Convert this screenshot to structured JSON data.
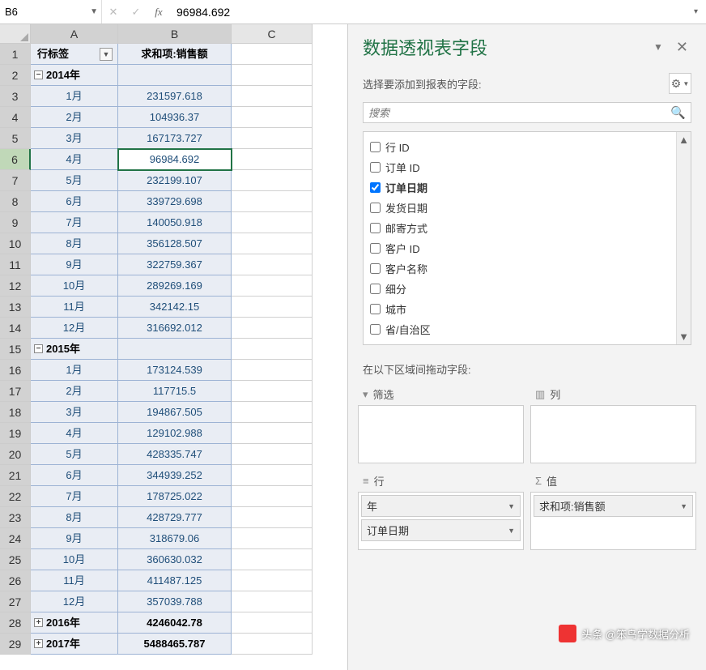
{
  "formula_bar": {
    "cell_ref": "B6",
    "value": "96984.692"
  },
  "columns": [
    "A",
    "B",
    "C"
  ],
  "headers": {
    "a": "行标签",
    "b": "求和项:销售额"
  },
  "rows": [
    {
      "n": 1,
      "type": "header"
    },
    {
      "n": 2,
      "type": "year",
      "label": "2014年",
      "exp": "−"
    },
    {
      "n": 3,
      "a": "1月",
      "b": "231597.618"
    },
    {
      "n": 4,
      "a": "2月",
      "b": "104936.37"
    },
    {
      "n": 5,
      "a": "3月",
      "b": "167173.727"
    },
    {
      "n": 6,
      "a": "4月",
      "b": "96984.692",
      "active": true
    },
    {
      "n": 7,
      "a": "5月",
      "b": "232199.107"
    },
    {
      "n": 8,
      "a": "6月",
      "b": "339729.698"
    },
    {
      "n": 9,
      "a": "7月",
      "b": "140050.918"
    },
    {
      "n": 10,
      "a": "8月",
      "b": "356128.507"
    },
    {
      "n": 11,
      "a": "9月",
      "b": "322759.367"
    },
    {
      "n": 12,
      "a": "10月",
      "b": "289269.169"
    },
    {
      "n": 13,
      "a": "11月",
      "b": "342142.15"
    },
    {
      "n": 14,
      "a": "12月",
      "b": "316692.012"
    },
    {
      "n": 15,
      "type": "year",
      "label": "2015年",
      "exp": "−"
    },
    {
      "n": 16,
      "a": "1月",
      "b": "173124.539"
    },
    {
      "n": 17,
      "a": "2月",
      "b": "117715.5"
    },
    {
      "n": 18,
      "a": "3月",
      "b": "194867.505"
    },
    {
      "n": 19,
      "a": "4月",
      "b": "129102.988"
    },
    {
      "n": 20,
      "a": "5月",
      "b": "428335.747"
    },
    {
      "n": 21,
      "a": "6月",
      "b": "344939.252"
    },
    {
      "n": 22,
      "a": "7月",
      "b": "178725.022"
    },
    {
      "n": 23,
      "a": "8月",
      "b": "428729.777"
    },
    {
      "n": 24,
      "a": "9月",
      "b": "318679.06"
    },
    {
      "n": 25,
      "a": "10月",
      "b": "360630.032"
    },
    {
      "n": 26,
      "a": "11月",
      "b": "411487.125"
    },
    {
      "n": 27,
      "a": "12月",
      "b": "357039.788"
    },
    {
      "n": 28,
      "type": "year-collapsed",
      "label": "2016年",
      "exp": "+",
      "b": "4246042.78"
    },
    {
      "n": 29,
      "type": "year-collapsed",
      "label": "2017年",
      "exp": "+",
      "b": "5488465.787"
    }
  ],
  "panel": {
    "title": "数据透视表字段",
    "subtitle": "选择要添加到报表的字段:",
    "search_placeholder": "搜索",
    "fields": [
      {
        "label": "行 ID",
        "checked": false
      },
      {
        "label": "订单 ID",
        "checked": false
      },
      {
        "label": "订单日期",
        "checked": true
      },
      {
        "label": "发货日期",
        "checked": false
      },
      {
        "label": "邮寄方式",
        "checked": false
      },
      {
        "label": "客户 ID",
        "checked": false
      },
      {
        "label": "客户名称",
        "checked": false
      },
      {
        "label": "细分",
        "checked": false
      },
      {
        "label": "城市",
        "checked": false
      },
      {
        "label": "省/自治区",
        "checked": false
      }
    ],
    "drag_label": "在以下区域间拖动字段:",
    "areas": {
      "filter": {
        "label": "筛选",
        "items": []
      },
      "columns": {
        "label": "列",
        "items": []
      },
      "rows": {
        "label": "行",
        "items": [
          "年",
          "订单日期"
        ]
      },
      "values": {
        "label": "值",
        "items": [
          "求和项:销售额"
        ]
      }
    }
  },
  "watermark": "头条 @笨鸟学数据分析"
}
